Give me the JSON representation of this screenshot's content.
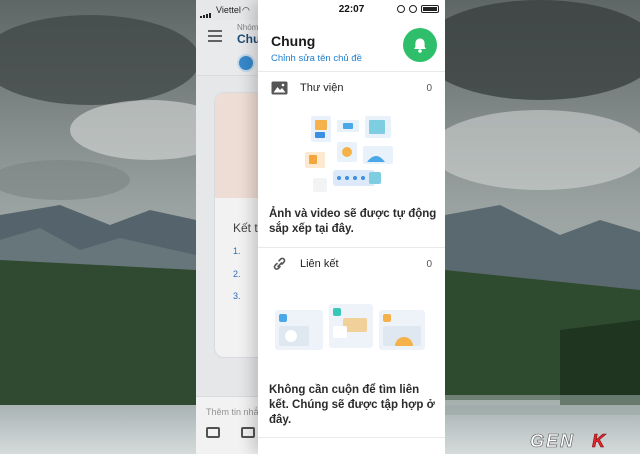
{
  "background": {
    "sky": "#7d8788",
    "mountain": "#5b6b73",
    "forest": "#2c4a2e",
    "water": "#b8c1c2"
  },
  "underlay": {
    "carrier": "Viettel",
    "group_label": "Nhóm",
    "group_name": "Chu",
    "card_title": "Kết t",
    "list_items": [
      "1.",
      "2.",
      "3."
    ],
    "composer_placeholder": "Thêm tin nhắ"
  },
  "drawer": {
    "time": "22:07",
    "title": "Chung",
    "edit_link": "Chỉnh sửa tên chủ đề",
    "accent": "#2fbf6a",
    "link_color": "#1e7fd1",
    "gallery": {
      "label": "Thư viện",
      "count": "0",
      "icon": "image-icon",
      "empty_message": "Ảnh và video sẽ được tự động sắp xếp tại đây."
    },
    "links": {
      "label": "Liên kết",
      "count": "0",
      "icon": "link-icon",
      "empty_message": "Không cần cuộn để tìm liên kết. Chúng sẽ được tập hợp ở đây."
    }
  },
  "watermark": "GENK"
}
